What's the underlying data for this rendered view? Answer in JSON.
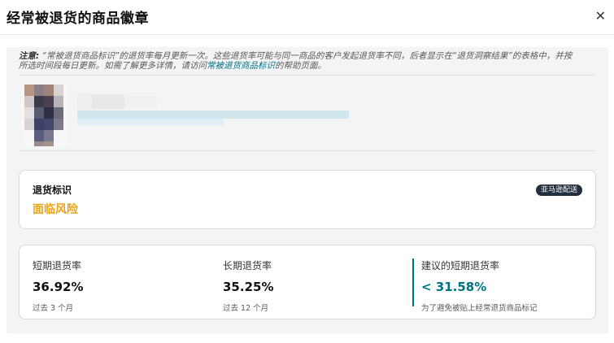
{
  "dialog": {
    "title": "经常被退货的商品徽章",
    "close_icon": "✕"
  },
  "note": {
    "label": "注意:",
    "text_before_link": "“常被退货商品标识”的退货率每月更新一次。这些退货率可能与同一商品的客户发起退货率不同，后者显示在“退货洞察结果”的表格中，并按所选时间段每日更新。如需了解更多详情，请访问",
    "link_text": "常被退货商品标识",
    "text_after_link": "的帮助页面。"
  },
  "product": {
    "thumbnail": "blurred-product-image",
    "title": "",
    "subtitle": ""
  },
  "return_badge": {
    "label": "退货标识",
    "status": "面临风险",
    "status_color": "#e8a317",
    "fulfillment_badge": "亚马逊配送"
  },
  "metrics": {
    "short_term": {
      "label": "短期退货率",
      "value": "36.92%",
      "period": "过去 3 个月"
    },
    "long_term": {
      "label": "长期退货率",
      "value": "35.25%",
      "period": "过去 12 个月"
    },
    "recommended": {
      "label": "建议的短期退货率",
      "value": "< 31.58%",
      "note": "为了避免被贴上经常退货商品标记",
      "accent": "#007185"
    }
  }
}
